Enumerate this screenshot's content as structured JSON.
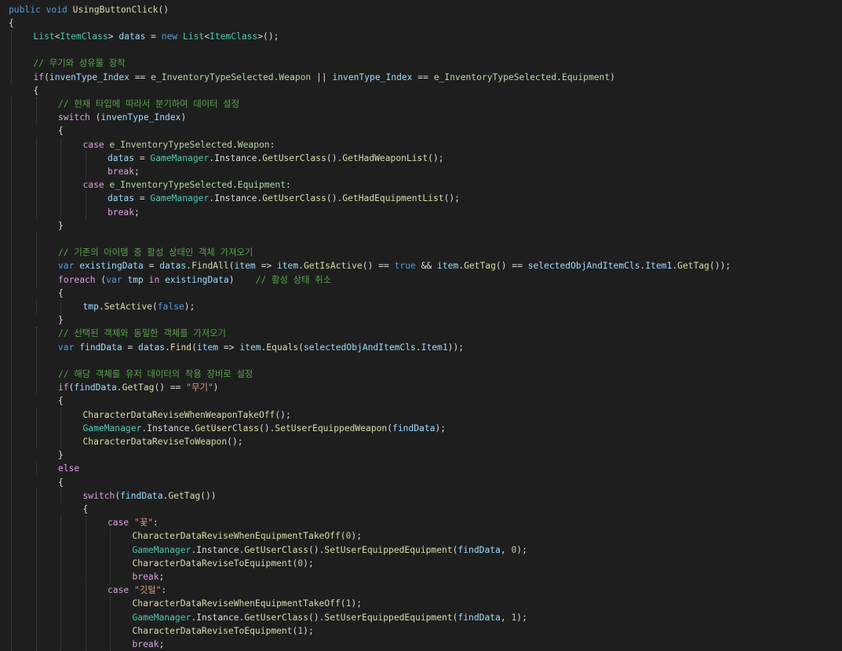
{
  "editor": {
    "lines": [
      {
        "i": 0,
        "t": [
          [
            "kw",
            "public"
          ],
          [
            "plain",
            " "
          ],
          [
            "kw",
            "void"
          ],
          [
            "plain",
            " "
          ],
          [
            "fn",
            "UsingButtonClick"
          ],
          [
            "plain",
            "()"
          ]
        ]
      },
      {
        "i": 0,
        "t": [
          [
            "plain",
            "{"
          ]
        ]
      },
      {
        "i": 1,
        "t": [
          [
            "type",
            "List"
          ],
          [
            "plain",
            "<"
          ],
          [
            "type",
            "ItemClass"
          ],
          [
            "plain",
            "> "
          ],
          [
            "var",
            "datas"
          ],
          [
            "plain",
            " = "
          ],
          [
            "kw",
            "new"
          ],
          [
            "plain",
            " "
          ],
          [
            "type",
            "List"
          ],
          [
            "plain",
            "<"
          ],
          [
            "type",
            "ItemClass"
          ],
          [
            "plain",
            ">();"
          ]
        ]
      },
      {
        "i": 1,
        "t": []
      },
      {
        "i": 1,
        "t": [
          [
            "cmt",
            "// 무기와 성유물 장착"
          ]
        ]
      },
      {
        "i": 1,
        "t": [
          [
            "ctl",
            "if"
          ],
          [
            "plain",
            "("
          ],
          [
            "var",
            "invenType_Index"
          ],
          [
            "plain",
            " == "
          ],
          [
            "enum",
            "e_InventoryTypeSelected"
          ],
          [
            "plain",
            "."
          ],
          [
            "enum",
            "Weapon"
          ],
          [
            "plain",
            " || "
          ],
          [
            "var",
            "invenType_Index"
          ],
          [
            "plain",
            " == "
          ],
          [
            "enum",
            "e_InventoryTypeSelected"
          ],
          [
            "plain",
            "."
          ],
          [
            "enum",
            "Equipment"
          ],
          [
            "plain",
            ")"
          ]
        ]
      },
      {
        "i": 1,
        "t": [
          [
            "plain",
            "{"
          ]
        ]
      },
      {
        "i": 2,
        "t": [
          [
            "cmt",
            "// 현재 타입에 따라서 분기하여 데이터 설정"
          ]
        ]
      },
      {
        "i": 2,
        "t": [
          [
            "ctl",
            "switch"
          ],
          [
            "plain",
            " ("
          ],
          [
            "var",
            "invenType_Index"
          ],
          [
            "plain",
            ")"
          ]
        ]
      },
      {
        "i": 2,
        "t": [
          [
            "plain",
            "{"
          ]
        ]
      },
      {
        "i": 3,
        "t": [
          [
            "ctl",
            "case"
          ],
          [
            "plain",
            " "
          ],
          [
            "enum",
            "e_InventoryTypeSelected"
          ],
          [
            "plain",
            "."
          ],
          [
            "enum",
            "Weapon"
          ],
          [
            "plain",
            ":"
          ]
        ]
      },
      {
        "i": 4,
        "t": [
          [
            "var",
            "datas"
          ],
          [
            "plain",
            " = "
          ],
          [
            "cls",
            "GameManager"
          ],
          [
            "plain",
            "."
          ],
          [
            "plain",
            "Instance"
          ],
          [
            "plain",
            "."
          ],
          [
            "fn",
            "GetUserClass"
          ],
          [
            "plain",
            "()."
          ],
          [
            "fn",
            "GetHadWeaponList"
          ],
          [
            "plain",
            "();"
          ]
        ]
      },
      {
        "i": 4,
        "t": [
          [
            "ctl",
            "break"
          ],
          [
            "plain",
            ";"
          ]
        ]
      },
      {
        "i": 3,
        "t": [
          [
            "ctl",
            "case"
          ],
          [
            "plain",
            " "
          ],
          [
            "enum",
            "e_InventoryTypeSelected"
          ],
          [
            "plain",
            "."
          ],
          [
            "enum",
            "Equipment"
          ],
          [
            "plain",
            ":"
          ]
        ]
      },
      {
        "i": 4,
        "t": [
          [
            "var",
            "datas"
          ],
          [
            "plain",
            " = "
          ],
          [
            "cls",
            "GameManager"
          ],
          [
            "plain",
            "."
          ],
          [
            "plain",
            "Instance"
          ],
          [
            "plain",
            "."
          ],
          [
            "fn",
            "GetUserClass"
          ],
          [
            "plain",
            "()."
          ],
          [
            "fn",
            "GetHadEquipmentList"
          ],
          [
            "plain",
            "();"
          ]
        ]
      },
      {
        "i": 4,
        "t": [
          [
            "ctl",
            "break"
          ],
          [
            "plain",
            ";"
          ]
        ]
      },
      {
        "i": 2,
        "t": [
          [
            "plain",
            "}"
          ]
        ]
      },
      {
        "i": 2,
        "t": []
      },
      {
        "i": 2,
        "t": [
          [
            "cmt",
            "// 기존의 아이템 중 활성 상태인 객체 가져오기"
          ]
        ]
      },
      {
        "i": 2,
        "t": [
          [
            "kw",
            "var"
          ],
          [
            "plain",
            " "
          ],
          [
            "var",
            "existingData"
          ],
          [
            "plain",
            " = "
          ],
          [
            "var",
            "datas"
          ],
          [
            "plain",
            "."
          ],
          [
            "fn",
            "FindAll"
          ],
          [
            "plain",
            "("
          ],
          [
            "var",
            "item"
          ],
          [
            "plain",
            " => "
          ],
          [
            "var",
            "item"
          ],
          [
            "plain",
            "."
          ],
          [
            "fn",
            "GetIsActive"
          ],
          [
            "plain",
            "() == "
          ],
          [
            "kw",
            "true"
          ],
          [
            "plain",
            " && "
          ],
          [
            "var",
            "item"
          ],
          [
            "plain",
            "."
          ],
          [
            "fn",
            "GetTag"
          ],
          [
            "plain",
            "() == "
          ],
          [
            "var",
            "selectedObjAndItemCls"
          ],
          [
            "plain",
            "."
          ],
          [
            "var",
            "Item1"
          ],
          [
            "plain",
            "."
          ],
          [
            "fn",
            "GetTag"
          ],
          [
            "plain",
            "());"
          ]
        ]
      },
      {
        "i": 2,
        "t": [
          [
            "ctl",
            "foreach"
          ],
          [
            "plain",
            " ("
          ],
          [
            "kw",
            "var"
          ],
          [
            "plain",
            " "
          ],
          [
            "var",
            "tmp"
          ],
          [
            "plain",
            " "
          ],
          [
            "ctl",
            "in"
          ],
          [
            "plain",
            " "
          ],
          [
            "var",
            "existingData"
          ],
          [
            "plain",
            ")    "
          ],
          [
            "cmt",
            "// 활성 상태 취소"
          ]
        ]
      },
      {
        "i": 2,
        "t": [
          [
            "plain",
            "{"
          ]
        ]
      },
      {
        "i": 3,
        "t": [
          [
            "var",
            "tmp"
          ],
          [
            "plain",
            "."
          ],
          [
            "fn",
            "SetActive"
          ],
          [
            "plain",
            "("
          ],
          [
            "kw",
            "false"
          ],
          [
            "plain",
            ");"
          ]
        ]
      },
      {
        "i": 2,
        "t": [
          [
            "plain",
            "}"
          ]
        ]
      },
      {
        "i": 2,
        "t": [
          [
            "cmt",
            "// 선택된 객체와 동일한 객체를 가져오기"
          ]
        ]
      },
      {
        "i": 2,
        "t": [
          [
            "kw",
            "var"
          ],
          [
            "plain",
            " "
          ],
          [
            "var",
            "findData"
          ],
          [
            "plain",
            " = "
          ],
          [
            "var",
            "datas"
          ],
          [
            "plain",
            "."
          ],
          [
            "fn",
            "Find"
          ],
          [
            "plain",
            "("
          ],
          [
            "var",
            "item"
          ],
          [
            "plain",
            " => "
          ],
          [
            "var",
            "item"
          ],
          [
            "plain",
            "."
          ],
          [
            "fn",
            "Equals"
          ],
          [
            "plain",
            "("
          ],
          [
            "var",
            "selectedObjAndItemCls"
          ],
          [
            "plain",
            "."
          ],
          [
            "var",
            "Item1"
          ],
          [
            "plain",
            "));"
          ]
        ]
      },
      {
        "i": 2,
        "t": []
      },
      {
        "i": 2,
        "t": [
          [
            "cmt",
            "// 해당 객체를 유저 데이터의 착용 장비로 설정"
          ]
        ]
      },
      {
        "i": 2,
        "t": [
          [
            "ctl",
            "if"
          ],
          [
            "plain",
            "("
          ],
          [
            "var",
            "findData"
          ],
          [
            "plain",
            "."
          ],
          [
            "fn",
            "GetTag"
          ],
          [
            "plain",
            "() == "
          ],
          [
            "str",
            "\"무기\""
          ],
          [
            "plain",
            ")"
          ]
        ]
      },
      {
        "i": 2,
        "t": [
          [
            "plain",
            "{"
          ]
        ]
      },
      {
        "i": 3,
        "t": [
          [
            "fn",
            "CharacterDataReviseWhenWeaponTakeOff"
          ],
          [
            "plain",
            "();"
          ]
        ]
      },
      {
        "i": 3,
        "t": [
          [
            "cls",
            "GameManager"
          ],
          [
            "plain",
            "."
          ],
          [
            "plain",
            "Instance"
          ],
          [
            "plain",
            "."
          ],
          [
            "fn",
            "GetUserClass"
          ],
          [
            "plain",
            "()."
          ],
          [
            "fn",
            "SetUserEquippedWeapon"
          ],
          [
            "plain",
            "("
          ],
          [
            "var",
            "findData"
          ],
          [
            "plain",
            ");"
          ]
        ]
      },
      {
        "i": 3,
        "t": [
          [
            "fn",
            "CharacterDataReviseToWeapon"
          ],
          [
            "plain",
            "();"
          ]
        ]
      },
      {
        "i": 2,
        "t": [
          [
            "plain",
            "}"
          ]
        ]
      },
      {
        "i": 2,
        "t": [
          [
            "ctl",
            "else"
          ]
        ]
      },
      {
        "i": 2,
        "t": [
          [
            "plain",
            "{"
          ]
        ]
      },
      {
        "i": 3,
        "t": [
          [
            "ctl",
            "switch"
          ],
          [
            "plain",
            "("
          ],
          [
            "var",
            "findData"
          ],
          [
            "plain",
            "."
          ],
          [
            "fn",
            "GetTag"
          ],
          [
            "plain",
            "())"
          ]
        ]
      },
      {
        "i": 3,
        "t": [
          [
            "plain",
            "{"
          ]
        ]
      },
      {
        "i": 4,
        "t": [
          [
            "ctl",
            "case"
          ],
          [
            "plain",
            " "
          ],
          [
            "str",
            "\"꽃\""
          ],
          [
            "plain",
            ":"
          ]
        ]
      },
      {
        "i": 5,
        "t": [
          [
            "fn",
            "CharacterDataReviseWhenEquipmentTakeOff"
          ],
          [
            "plain",
            "("
          ],
          [
            "num",
            "0"
          ],
          [
            "plain",
            ");"
          ]
        ]
      },
      {
        "i": 5,
        "t": [
          [
            "cls",
            "GameManager"
          ],
          [
            "plain",
            "."
          ],
          [
            "plain",
            "Instance"
          ],
          [
            "plain",
            "."
          ],
          [
            "fn",
            "GetUserClass"
          ],
          [
            "plain",
            "()."
          ],
          [
            "fn",
            "SetUserEquippedEquipment"
          ],
          [
            "plain",
            "("
          ],
          [
            "var",
            "findData"
          ],
          [
            "plain",
            ", "
          ],
          [
            "num",
            "0"
          ],
          [
            "plain",
            ");"
          ]
        ]
      },
      {
        "i": 5,
        "t": [
          [
            "fn",
            "CharacterDataReviseToEquipment"
          ],
          [
            "plain",
            "("
          ],
          [
            "num",
            "0"
          ],
          [
            "plain",
            ");"
          ]
        ]
      },
      {
        "i": 5,
        "t": [
          [
            "ctl",
            "break"
          ],
          [
            "plain",
            ";"
          ]
        ]
      },
      {
        "i": 4,
        "t": [
          [
            "ctl",
            "case"
          ],
          [
            "plain",
            " "
          ],
          [
            "str",
            "\"깃털\""
          ],
          [
            "plain",
            ":"
          ]
        ]
      },
      {
        "i": 5,
        "t": [
          [
            "fn",
            "CharacterDataReviseWhenEquipmentTakeOff"
          ],
          [
            "plain",
            "("
          ],
          [
            "num",
            "1"
          ],
          [
            "plain",
            ");"
          ]
        ]
      },
      {
        "i": 5,
        "t": [
          [
            "cls",
            "GameManager"
          ],
          [
            "plain",
            "."
          ],
          [
            "plain",
            "Instance"
          ],
          [
            "plain",
            "."
          ],
          [
            "fn",
            "GetUserClass"
          ],
          [
            "plain",
            "()."
          ],
          [
            "fn",
            "SetUserEquippedEquipment"
          ],
          [
            "plain",
            "("
          ],
          [
            "var",
            "findData"
          ],
          [
            "plain",
            ", "
          ],
          [
            "num",
            "1"
          ],
          [
            "plain",
            ");"
          ]
        ]
      },
      {
        "i": 5,
        "t": [
          [
            "fn",
            "CharacterDataReviseToEquipment"
          ],
          [
            "plain",
            "("
          ],
          [
            "num",
            "1"
          ],
          [
            "plain",
            ");"
          ]
        ]
      },
      {
        "i": 5,
        "t": [
          [
            "ctl",
            "break"
          ],
          [
            "plain",
            ";"
          ]
        ]
      }
    ]
  }
}
